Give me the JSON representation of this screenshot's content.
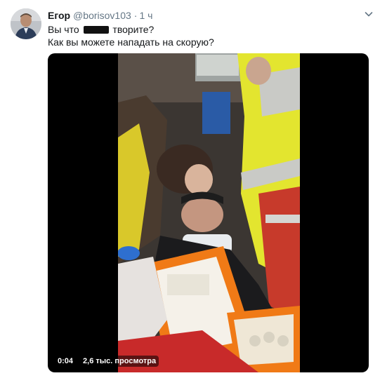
{
  "tweet": {
    "author_name": "Егор",
    "handle": "@borisov103",
    "separator": "·",
    "time": "1 ч",
    "text_line1_before": "Вы что",
    "text_line1_after": "творите?",
    "text_line2": "Как вы можете нападать на скорую?",
    "censored": true
  },
  "video": {
    "elapsed": "0:04",
    "views": "2,6 тыс. просмотра"
  },
  "icons": {
    "menu": "chevron-down-icon",
    "avatar": "avatar"
  },
  "colors": {
    "name": "#14171a",
    "secondary": "#657786",
    "video_bg": "#000000",
    "paramedic_jacket": "#e3e52f",
    "kit_orange": "#f07a16"
  }
}
